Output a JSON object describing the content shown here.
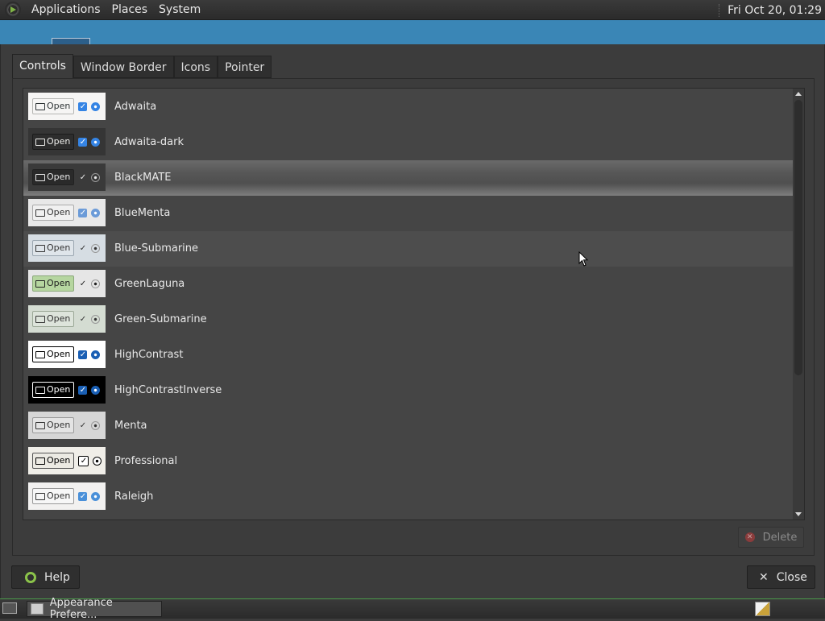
{
  "top_panel": {
    "menus": [
      "Applications",
      "Places",
      "System"
    ],
    "clock": "Fri Oct 20, 01:29"
  },
  "tabs": [
    {
      "label": "Controls",
      "active": true
    },
    {
      "label": "Window Border",
      "active": false
    },
    {
      "label": "Icons",
      "active": false
    },
    {
      "label": "Pointer",
      "active": false
    }
  ],
  "themes": [
    {
      "name": "Adwaita",
      "preview": {
        "bg": "#f6f5f4",
        "btn_bg": "#f6f5f4",
        "btn_fg": "#2e3436",
        "btn_border": "#b6b6b3",
        "check": "#3584e4",
        "radio": "#3584e4",
        "open": "Open"
      }
    },
    {
      "name": "Adwaita-dark",
      "preview": {
        "bg": "#353535",
        "btn_bg": "#2d2d2d",
        "btn_fg": "#eeeeec",
        "btn_border": "#1b1b1b",
        "check": "#3584e4",
        "radio": "#3584e4",
        "open": "Open"
      }
    },
    {
      "name": "BlackMATE",
      "preview": {
        "bg": "#3a3a3a",
        "btn_bg": "#2a2a2a",
        "btn_fg": "#e8e8e8",
        "btn_border": "#222222",
        "check": "#3a3a3a",
        "radio": "#3a3a3a",
        "open": "Open"
      },
      "selected": true
    },
    {
      "name": "BlueMenta",
      "preview": {
        "bg": "#e8e8e8",
        "btn_bg": "#f0f0f0",
        "btn_fg": "#333333",
        "btn_border": "#aaaaaa",
        "check": "#6b9bd8",
        "radio": "#6b9bd8",
        "open": "Open"
      }
    },
    {
      "name": "Blue-Submarine",
      "preview": {
        "bg": "#d6dde3",
        "btn_bg": "#dfe5ea",
        "btn_fg": "#333333",
        "btn_border": "#9aa6b0",
        "check": "#d6dde3",
        "radio": "#d6dde3",
        "open": "Open"
      },
      "hover": true
    },
    {
      "name": "GreenLaguna",
      "preview": {
        "bg": "#e6e6e6",
        "btn_bg": "#b6d6a0",
        "btn_fg": "#222222",
        "btn_border": "#8aa87a",
        "check": "#e6e6e6",
        "radio": "#e6e6e6",
        "open": "Open"
      }
    },
    {
      "name": "Green-Submarine",
      "preview": {
        "bg": "#d4dcd2",
        "btn_bg": "#dde4db",
        "btn_fg": "#333333",
        "btn_border": "#9ba897",
        "check": "#d4dcd2",
        "radio": "#d4dcd2",
        "open": "Open"
      }
    },
    {
      "name": "HighContrast",
      "preview": {
        "bg": "#ffffff",
        "btn_bg": "#ffffff",
        "btn_fg": "#000000",
        "btn_border": "#000000",
        "check": "#1a5fb4",
        "radio": "#1a5fb4",
        "open": "Open"
      }
    },
    {
      "name": "HighContrastInverse",
      "preview": {
        "bg": "#000000",
        "btn_bg": "#000000",
        "btn_fg": "#ffffff",
        "btn_border": "#ffffff",
        "check": "#1a5fb4",
        "radio": "#1a5fb4",
        "open": "Open"
      }
    },
    {
      "name": "Menta",
      "preview": {
        "bg": "#d6d6d6",
        "btn_bg": "#e4e4e4",
        "btn_fg": "#333333",
        "btn_border": "#9a9a9a",
        "check": "#d6d6d6",
        "radio": "#d6d6d6",
        "open": "Open"
      }
    },
    {
      "name": "Professional",
      "preview": {
        "bg": "#f0eee8",
        "btn_bg": "#eceae3",
        "btn_fg": "#000000",
        "btn_border": "#555555",
        "check": "#ffffff",
        "radio": "#ffffff",
        "open": "Open"
      }
    },
    {
      "name": "Raleigh",
      "preview": {
        "bg": "#f2f1f0",
        "btn_bg": "#f7f7f7",
        "btn_fg": "#333333",
        "btn_border": "#9a9a9a",
        "check": "#4a90d9",
        "radio": "#4a90d9",
        "open": "Open"
      }
    }
  ],
  "buttons": {
    "delete": "Delete",
    "help": "Help",
    "close": "Close"
  },
  "taskbar": {
    "window_title": "Appearance Prefere..."
  },
  "icons": {
    "logo": "mate-logo-icon",
    "folder": "folder-icon",
    "delete": "delete-icon",
    "help": "help-icon",
    "close": "close-icon",
    "show_desktop": "show-desktop-icon"
  }
}
